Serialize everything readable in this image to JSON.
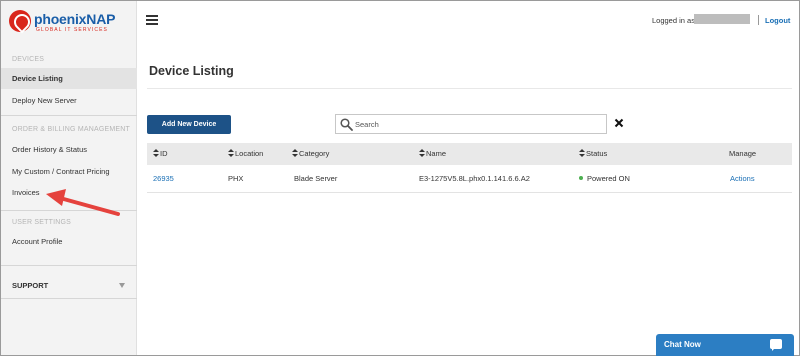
{
  "brand": {
    "name_a": "phoenix",
    "name_b": "NAP",
    "tagline": "GLOBAL IT SERVICES",
    "color": "#d9261c",
    "text_color": "#1a5ea8"
  },
  "sidebar": {
    "section_devices": "DEVICES",
    "item_device_listing": "Device Listing",
    "item_deploy": "Deploy New Server",
    "section_billing": "ORDER & BILLING MANAGEMENT",
    "item_order_history": "Order History & Status",
    "item_pricing": "My Custom / Contract Pricing",
    "item_invoices": "Invoices",
    "section_user": "USER SETTINGS",
    "item_account": "Account Profile",
    "support": "SUPPORT"
  },
  "header": {
    "logged_in_label": "Logged in as",
    "logout": "Logout"
  },
  "main": {
    "title": "Device Listing",
    "add_button": "Add New Device",
    "search_placeholder": "Search",
    "table": {
      "columns": [
        "ID",
        "Location",
        "Category",
        "Name",
        "Status",
        "Manage"
      ],
      "rows": [
        {
          "id": "26935",
          "location": "PHX",
          "category": "Blade Server",
          "name": "E3-1275V5.8L.phx0.1.141.6.6.A2",
          "status": "Powered ON",
          "manage": "Actions"
        }
      ]
    }
  },
  "chat": {
    "label": "Chat Now"
  },
  "colors": {
    "primary_button": "#1d5287",
    "link": "#1a6fb5",
    "chat": "#2c7ec3",
    "status_on": "#4caf50",
    "annotation_arrow": "#e5423d"
  },
  "icons": [
    "hamburger-icon",
    "search-icon",
    "close-icon",
    "sort-icon",
    "chevron-down-icon",
    "chat-icon",
    "status-dot-icon"
  ]
}
